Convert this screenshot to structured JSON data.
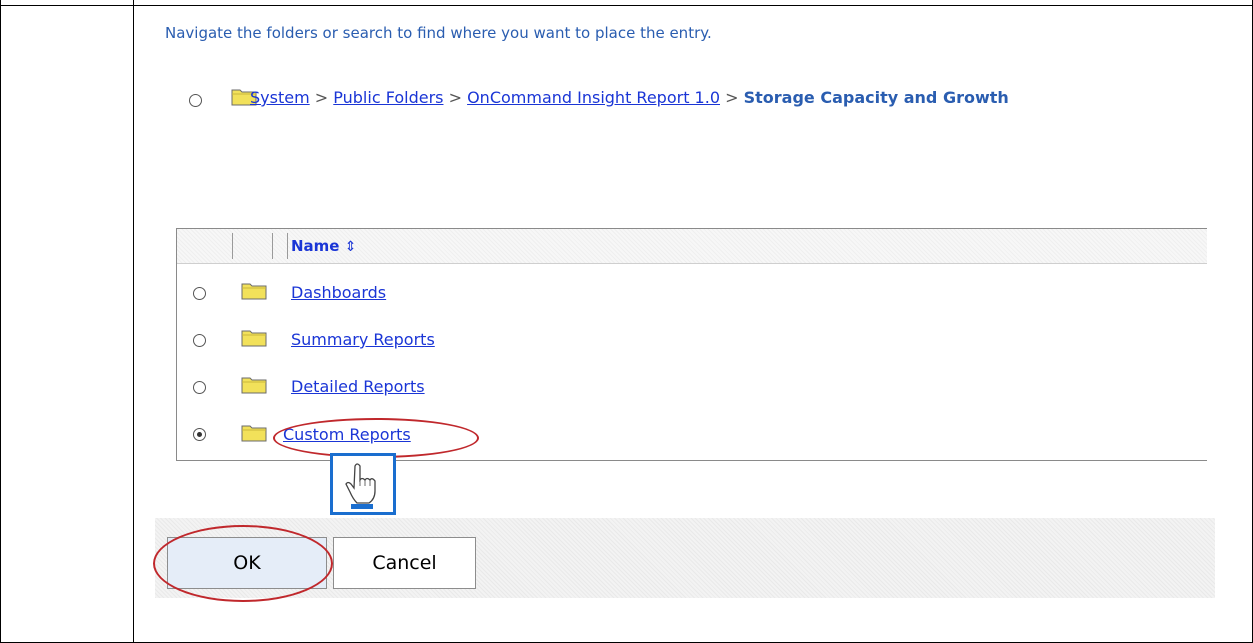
{
  "instruction": "Navigate the folders or search to find where you want to place the entry.",
  "breadcrumb": {
    "items": [
      "System",
      "Public Folders",
      "OnCommand Insight Report 1.0"
    ],
    "separator": ">",
    "current": "Storage Capacity and Growth"
  },
  "table": {
    "column_header": "Name",
    "sort_icon": "⇕",
    "rows": [
      {
        "label": "Dashboards",
        "selected": false
      },
      {
        "label": "Summary Reports",
        "selected": false
      },
      {
        "label": "Detailed Reports",
        "selected": false
      },
      {
        "label": "Custom Reports",
        "selected": true
      }
    ]
  },
  "buttons": {
    "ok": "OK",
    "cancel": "Cancel"
  },
  "colors": {
    "link": "#1a35d6",
    "accent_text": "#2a5db0",
    "annotation_red": "#c0282c",
    "annotation_blue": "#1a6ecf",
    "folder_yellow": "#f2e15a"
  },
  "icons": {
    "folder": "folder-icon",
    "cursor": "pointing-hand-icon",
    "sort": "sort-icon"
  }
}
